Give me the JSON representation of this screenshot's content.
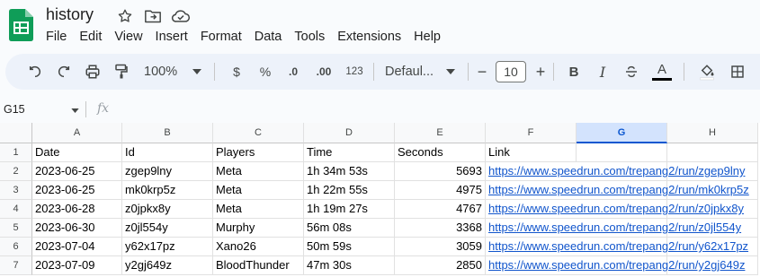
{
  "app": {
    "doc_title": "history",
    "title_icons": [
      "star-icon",
      "move-to-folder-icon",
      "cloud-saved-icon"
    ]
  },
  "menu": [
    "File",
    "Edit",
    "View",
    "Insert",
    "Format",
    "Data",
    "Tools",
    "Extensions",
    "Help"
  ],
  "toolbar": {
    "zoom": "100%",
    "currency": "$",
    "percent": "%",
    "decrease_decimal": ".0",
    "increase_decimal": ".00",
    "number_format": "123",
    "font": "Defaul...",
    "font_size": "10",
    "minus": "−",
    "plus": "+",
    "bold": "B",
    "italic": "I",
    "text_color_label": "A",
    "text_color": "#000000"
  },
  "formula_bar": {
    "name_box": "G15",
    "fx": "fx",
    "value": ""
  },
  "grid": {
    "columns": [
      "A",
      "B",
      "C",
      "D",
      "E",
      "F",
      "G",
      "H"
    ],
    "selected_column": "G",
    "row_numbers": [
      "1",
      "2",
      "3",
      "4",
      "5",
      "6",
      "7"
    ],
    "rows": [
      [
        "Date",
        "Id",
        "Players",
        "Time",
        "Seconds",
        "Link"
      ],
      [
        "2023-06-25",
        "zgep9lny",
        "Meta",
        "1h 34m 53s",
        "5693",
        "https://www.speedrun.com/trepang2/run/zgep9lny"
      ],
      [
        "2023-06-25",
        "mk0krp5z",
        "Meta",
        "1h 22m 55s",
        "4975",
        "https://www.speedrun.com/trepang2/run/mk0krp5z"
      ],
      [
        "2023-06-28",
        "z0jpkx8y",
        "Meta",
        "1h 19m 27s",
        "4767",
        "https://www.speedrun.com/trepang2/run/z0jpkx8y"
      ],
      [
        "2023-06-30",
        "z0jl554y",
        "Murphy",
        "56m 08s",
        "3368",
        "https://www.speedrun.com/trepang2/run/z0jl554y"
      ],
      [
        "2023-07-04",
        "y62x17pz",
        "Xano26",
        "50m 59s",
        "3059",
        "https://www.speedrun.com/trepang2/run/y62x17pz"
      ],
      [
        "2023-07-09",
        "y2gj649z",
        "BloodThunder",
        "47m 30s",
        "2850",
        "https://www.speedrun.com/trepang2/run/y2gj649z"
      ]
    ]
  },
  "colors": {
    "accent": "#0b57d0",
    "link": "#1155cc",
    "sheets_green": "#0f9d58"
  }
}
